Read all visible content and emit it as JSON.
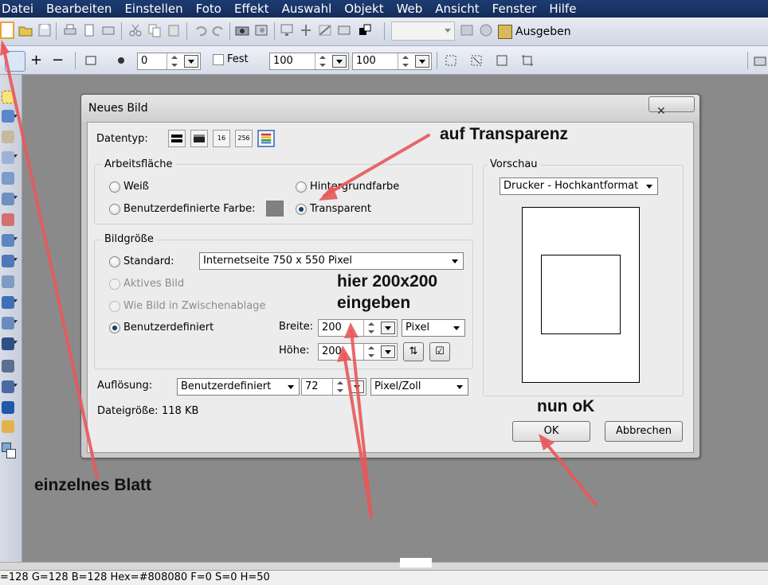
{
  "menubar": {
    "items": [
      "Datei",
      "Bearbeiten",
      "Einstellen",
      "Foto",
      "Effekt",
      "Auswahl",
      "Objekt",
      "Web",
      "Ansicht",
      "Fenster",
      "Hilfe"
    ]
  },
  "toolbar1": {
    "ausgeben_label": "Ausgeben"
  },
  "toolbar2": {
    "brush_size_value": "0",
    "fest_label": "Fest",
    "width_value": "100",
    "height_value": "100"
  },
  "dialog": {
    "title": "Neues Bild",
    "close_glyph": "✕",
    "datentyp_label": "Datentyp:",
    "datentyp_buttons": [
      "",
      "",
      "16",
      "256",
      ""
    ],
    "arbeitsflaeche": {
      "legend": "Arbeitsfläche",
      "weiss": "Weiß",
      "hintergrundfarbe": "Hintergrundfarbe",
      "benutzerdefinierte_farbe": "Benutzerdefinierte Farbe:",
      "transparent": "Transparent",
      "custom_color": "#808080"
    },
    "bildgroesse": {
      "legend": "Bildgröße",
      "standard_label": "Standard:",
      "standard_value": "Internetseite 750 x 550 Pixel",
      "aktives_bild": "Aktives Bild",
      "wie_bild": "Wie Bild in Zwischenablage",
      "benutzerdefiniert": "Benutzerdefiniert",
      "breite_label": "Breite:",
      "breite_value": "200",
      "hoehe_label": "Höhe:",
      "hoehe_value": "200",
      "unit_value": "Pixel"
    },
    "aufloesung": {
      "label": "Auflösung:",
      "mode_value": "Benutzerdefiniert",
      "value": "72",
      "unit_value": "Pixel/Zoll"
    },
    "dateigroesse": {
      "label": "Dateigröße:",
      "value": "118 KB"
    },
    "vorschau": {
      "legend": "Vorschau",
      "preset_value": "Drucker - Hochkantformat"
    },
    "ok_label": "OK",
    "abbrechen_label": "Abbrechen"
  },
  "annotations": {
    "auf_transparenz": "auf Transparenz",
    "hier_line1": "hier 200x200",
    "hier_line2": "eingeben",
    "nun_ok": "nun oK",
    "einzelnes_blatt": "einzelnes Blatt"
  },
  "status": {
    "text": "=128 G=128 B=128   Hex=#808080   F=0 S=0 H=50"
  },
  "colors": {
    "menubar": "#1d3b72",
    "arrow": "#e8585a",
    "workspace": "#8a8a8a"
  }
}
